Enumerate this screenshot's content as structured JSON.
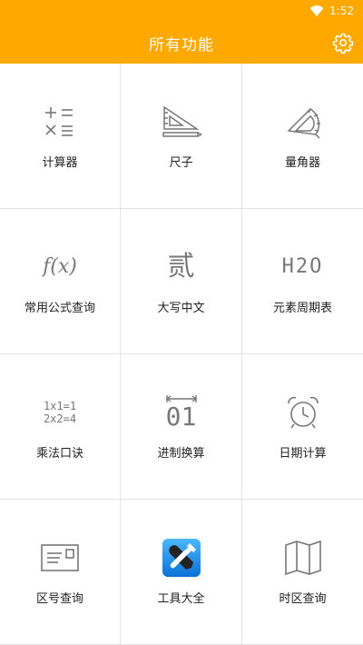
{
  "status_bar": {
    "time": "1:52"
  },
  "app_bar": {
    "title": "所有功能"
  },
  "tiles": [
    {
      "label": "计算器",
      "icon": "calculator-icon"
    },
    {
      "label": "尺子",
      "icon": "ruler-icon"
    },
    {
      "label": "量角器",
      "icon": "protractor-icon"
    },
    {
      "label": "常用公式查询",
      "icon": "formula-icon",
      "icon_text": "f(x)"
    },
    {
      "label": "大写中文",
      "icon": "chinese-numeral-icon",
      "icon_text": "贰"
    },
    {
      "label": "元素周期表",
      "icon": "periodic-table-icon",
      "icon_text": "H2O"
    },
    {
      "label": "乘法口诀",
      "icon": "multiplication-icon",
      "icon_text_line1": "1x1=1",
      "icon_text_line2": "2x2=4"
    },
    {
      "label": "进制换算",
      "icon": "base-conversion-icon",
      "icon_text": "01"
    },
    {
      "label": "日期计算",
      "icon": "alarm-clock-icon"
    },
    {
      "label": "区号查询",
      "icon": "postcard-icon"
    },
    {
      "label": "工具大全",
      "icon": "toolbox-icon"
    },
    {
      "label": "时区查询",
      "icon": "map-icon"
    }
  ],
  "colors": {
    "accent": "#ffa800",
    "icon_gray": "#777777",
    "toolbox_blue": "#1a8fe8"
  }
}
